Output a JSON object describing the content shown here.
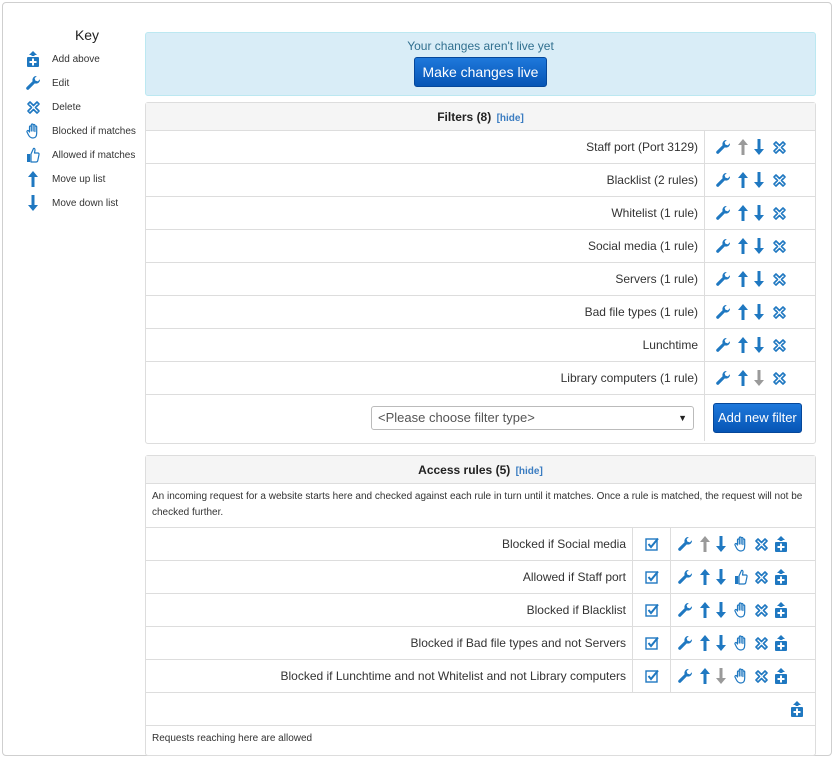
{
  "key": {
    "title": "Key",
    "items": [
      {
        "icon": "add-above-icon",
        "label": "Add above"
      },
      {
        "icon": "wrench-icon",
        "label": "Edit"
      },
      {
        "icon": "delete-icon",
        "label": "Delete"
      },
      {
        "icon": "hand-stop-icon",
        "label": "Blocked if matches"
      },
      {
        "icon": "thumbs-up-icon",
        "label": "Allowed if matches"
      },
      {
        "icon": "arrow-up-icon",
        "label": "Move up list"
      },
      {
        "icon": "arrow-down-icon",
        "label": "Move down list"
      }
    ]
  },
  "alert": {
    "text": "Your changes aren't live yet",
    "button_label": "Make changes live"
  },
  "filters": {
    "title": "Filters",
    "count": "(8)",
    "hide_label": "[hide]",
    "rows": [
      {
        "name": "Staff port (Port 3129)",
        "up_enabled": false,
        "down_enabled": true
      },
      {
        "name": "Blacklist (2 rules)",
        "up_enabled": true,
        "down_enabled": true
      },
      {
        "name": "Whitelist (1 rule)",
        "up_enabled": true,
        "down_enabled": true
      },
      {
        "name": "Social media (1 rule)",
        "up_enabled": true,
        "down_enabled": true
      },
      {
        "name": "Servers (1 rule)",
        "up_enabled": true,
        "down_enabled": true
      },
      {
        "name": "Bad file types (1 rule)",
        "up_enabled": true,
        "down_enabled": true
      },
      {
        "name": "Lunchtime",
        "up_enabled": true,
        "down_enabled": true
      },
      {
        "name": "Library computers (1 rule)",
        "up_enabled": true,
        "down_enabled": false
      }
    ],
    "select_value": "<Please choose filter type>",
    "add_button_label": "Add new filter"
  },
  "rules": {
    "title": "Access rules",
    "count": "(5)",
    "hide_label": "[hide]",
    "description": "An incoming request for a website starts here and checked against each rule in turn until it matches. Once a rule is matched, the request will not be checked further.",
    "rows": [
      {
        "name": "Blocked if Social media",
        "action": "block",
        "up_enabled": false,
        "down_enabled": true
      },
      {
        "name": "Allowed if Staff port",
        "action": "allow",
        "up_enabled": true,
        "down_enabled": true
      },
      {
        "name": "Blocked if Blacklist",
        "action": "block",
        "up_enabled": true,
        "down_enabled": true
      },
      {
        "name": "Blocked if Bad file types and not Servers",
        "action": "block",
        "up_enabled": true,
        "down_enabled": true
      },
      {
        "name": "Blocked if Lunchtime and not Whitelist and not Library computers",
        "action": "block",
        "up_enabled": true,
        "down_enabled": false
      }
    ],
    "footer": "Requests reaching here are allowed"
  },
  "colors": {
    "icon_blue": "#1f78c1",
    "icon_disabled": "#9a9a9a",
    "primary": "#0a63c9"
  }
}
